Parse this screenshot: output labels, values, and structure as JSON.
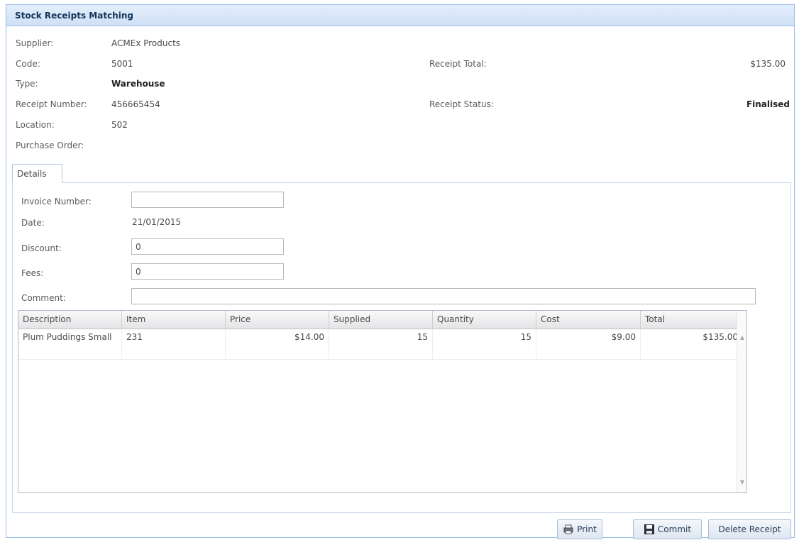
{
  "window": {
    "title": "Stock Receipts Matching"
  },
  "header": {
    "supplier_label": "Supplier:",
    "supplier_value": "ACMEx Products",
    "code_label": "Code:",
    "code_value": "5001",
    "type_label": "Type:",
    "type_value": "Warehouse",
    "receipt_number_label": "Receipt Number:",
    "receipt_number_value": "456665454",
    "location_label": "Location:",
    "location_value": "502",
    "purchase_order_label": "Purchase Order:",
    "purchase_order_value": "",
    "receipt_total_label": "Receipt Total:",
    "receipt_total_value": "$135.00",
    "receipt_status_label": "Receipt Status:",
    "receipt_status_value": "Finalised"
  },
  "tabs": [
    {
      "label": "Details",
      "active": true
    }
  ],
  "details": {
    "invoice_label": "Invoice Number:",
    "invoice_value": "",
    "date_label": "Date:",
    "date_value": "21/01/2015",
    "discount_label": "Discount:",
    "discount_value": "0",
    "fees_label": "Fees:",
    "fees_value": "0",
    "comment_label": "Comment:",
    "comment_value": ""
  },
  "grid": {
    "columns": [
      "Description",
      "Item",
      "Price",
      "Supplied",
      "Quantity",
      "Cost",
      "Total"
    ],
    "rows": [
      {
        "description": "Plum Puddings Small",
        "item": "231",
        "price": "$14.00",
        "supplied": "15",
        "quantity": "15",
        "cost": "$9.00",
        "total": "$135.00"
      }
    ]
  },
  "buttons": {
    "print": {
      "label": "Print",
      "icon": "printer-icon"
    },
    "commit": {
      "label": "Commit",
      "icon": "floppy-disk-icon"
    },
    "delete": {
      "label": "Delete Receipt"
    }
  },
  "colors": {
    "title_bar": "#cfe0f6",
    "border": "#99bce8",
    "button_text": "#2a3f5c"
  }
}
